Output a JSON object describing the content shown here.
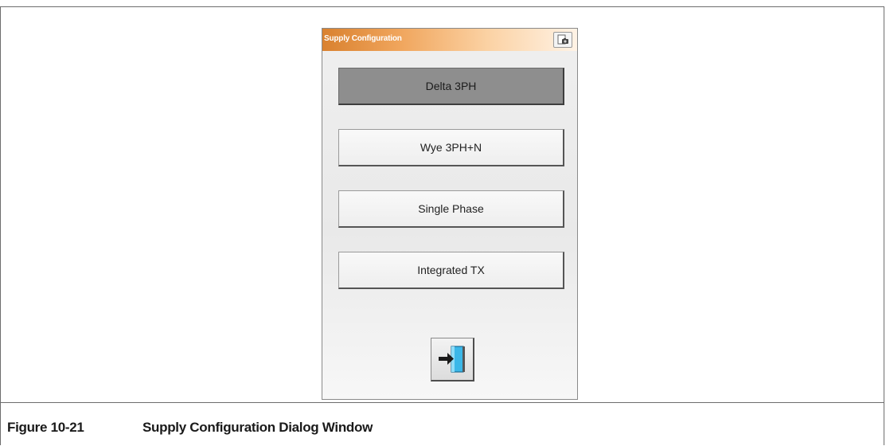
{
  "dialog": {
    "title": "Supply Configuration",
    "camera_icon": "camera-icon",
    "options": [
      {
        "label": "Delta 3PH",
        "selected": true
      },
      {
        "label": "Wye 3PH+N",
        "selected": false
      },
      {
        "label": "Single Phase",
        "selected": false
      },
      {
        "label": "Integrated TX",
        "selected": false
      }
    ],
    "exit_icon": "exit-door-icon"
  },
  "caption": {
    "number": "Figure 10-21",
    "text": "Supply Configuration Dialog Window"
  },
  "colors": {
    "titlebar_accent": "#f0a55c",
    "selected_button": "#8e8e8e",
    "door_blue": "#3bb7e8"
  }
}
